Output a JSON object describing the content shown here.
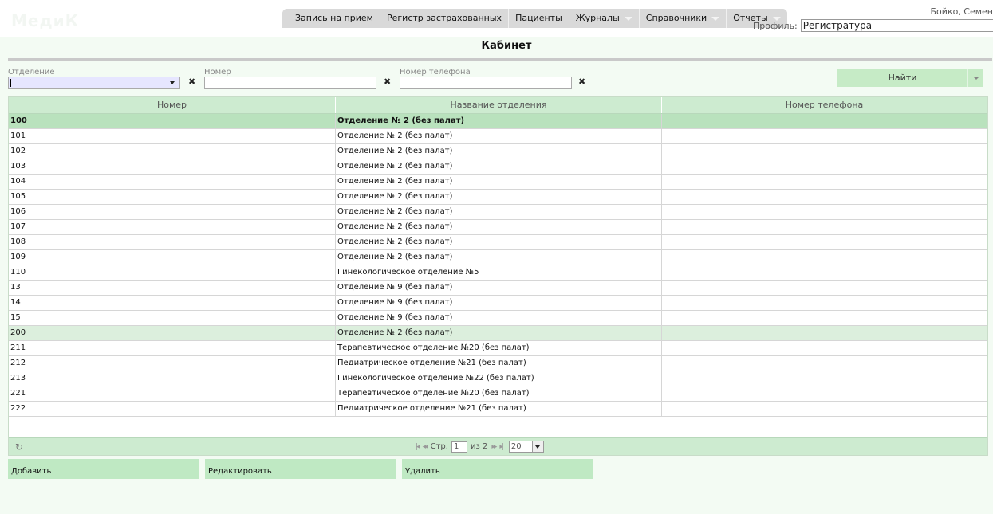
{
  "app": {
    "logo_text": "МедиК",
    "user_name": "Бойко, Семен",
    "profile_label": "Профиль:",
    "profile_value": "Регистратура"
  },
  "menu": [
    {
      "label": "Запись на прием",
      "dropdown": false
    },
    {
      "label": "Регистр застрахованных",
      "dropdown": false
    },
    {
      "label": "Пациенты",
      "dropdown": false
    },
    {
      "label": "Журналы",
      "dropdown": true
    },
    {
      "label": "Справочники",
      "dropdown": true
    },
    {
      "label": "Отчеты",
      "dropdown": true
    }
  ],
  "page_title": "Кабинет",
  "filters": {
    "department_label": "Отделение",
    "number_label": "Номер",
    "phone_label": "Номер телефона",
    "clear_glyph": "✖",
    "find_label": "Найти"
  },
  "grid": {
    "columns": [
      "Номер",
      "Название отделения",
      "Номер телефона"
    ],
    "rows": [
      {
        "number": "100",
        "department": "Отделение № 2 (без палат)",
        "phone": "",
        "state": "selected"
      },
      {
        "number": "101",
        "department": "Отделение № 2 (без палат)",
        "phone": ""
      },
      {
        "number": "102",
        "department": "Отделение № 2 (без палат)",
        "phone": ""
      },
      {
        "number": "103",
        "department": "Отделение № 2 (без палат)",
        "phone": ""
      },
      {
        "number": "104",
        "department": "Отделение № 2 (без палат)",
        "phone": ""
      },
      {
        "number": "105",
        "department": "Отделение № 2 (без палат)",
        "phone": ""
      },
      {
        "number": "106",
        "department": "Отделение № 2 (без палат)",
        "phone": ""
      },
      {
        "number": "107",
        "department": "Отделение № 2 (без палат)",
        "phone": ""
      },
      {
        "number": "108",
        "department": "Отделение № 2 (без палат)",
        "phone": ""
      },
      {
        "number": "109",
        "department": "Отделение № 2 (без палат)",
        "phone": ""
      },
      {
        "number": "110",
        "department": "Гинекологическое отделение №5",
        "phone": ""
      },
      {
        "number": "13",
        "department": "Отделение № 9 (без палат)",
        "phone": ""
      },
      {
        "number": "14",
        "department": "Отделение № 9 (без палат)",
        "phone": ""
      },
      {
        "number": "15",
        "department": "Отделение № 9 (без палат)",
        "phone": ""
      },
      {
        "number": "200",
        "department": "Отделение № 2 (без палат)",
        "phone": "",
        "state": "hover"
      },
      {
        "number": "211",
        "department": "Терапевтическое отделение №20 (без палат)",
        "phone": ""
      },
      {
        "number": "212",
        "department": "Педиатрическое отделение №21 (без палат)",
        "phone": ""
      },
      {
        "number": "213",
        "department": "Гинекологическое отделение №22 (без палат)",
        "phone": ""
      },
      {
        "number": "221",
        "department": "Терапевтическое отделение №20 (без палат)",
        "phone": ""
      },
      {
        "number": "222",
        "department": "Педиатрическое отделение №21 (без палат)",
        "phone": ""
      }
    ]
  },
  "pager": {
    "page_label": "Стр.",
    "page_value": "1",
    "of_label": "из 2",
    "page_size": "20"
  },
  "actions": {
    "add": "Добавить",
    "edit": "Редактировать",
    "delete": "Удалить"
  }
}
